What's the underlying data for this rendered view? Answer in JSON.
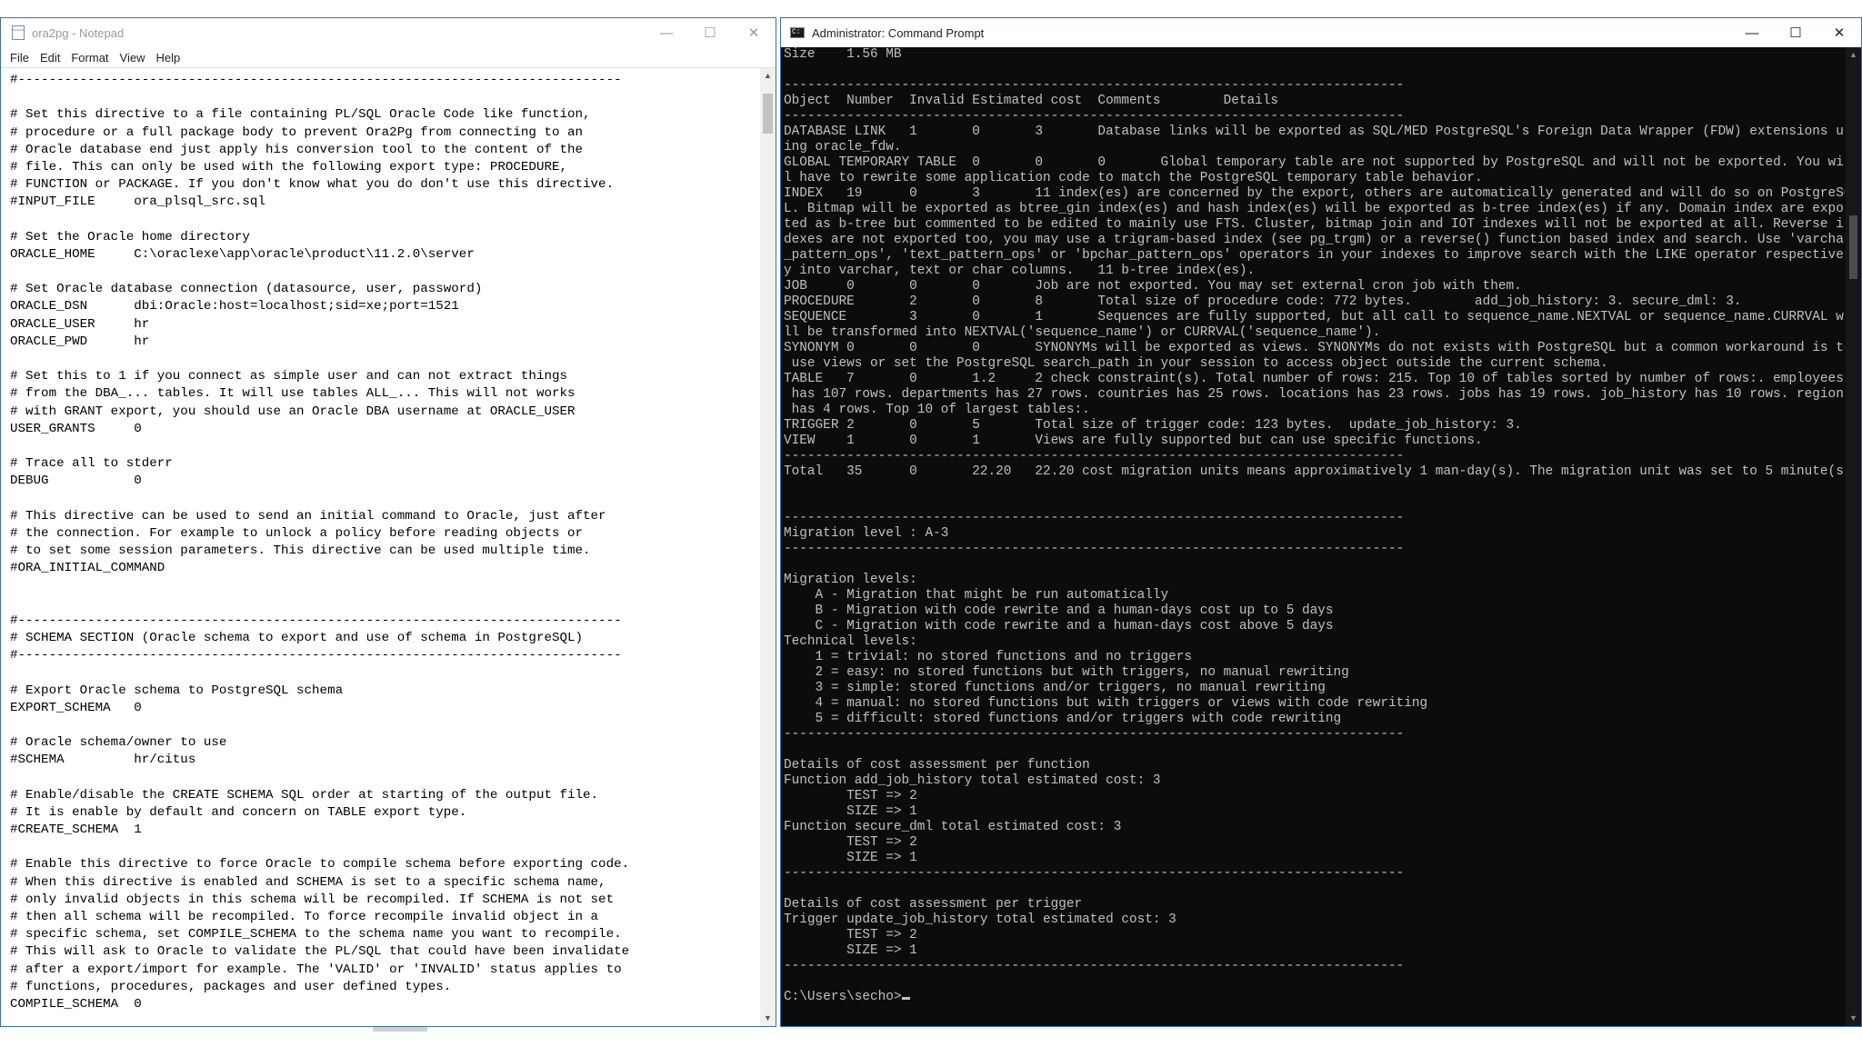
{
  "notepad": {
    "title": "ora2pg - Notepad",
    "menu": [
      "File",
      "Edit",
      "Format",
      "View",
      "Help"
    ],
    "lines": [
      "#------------------------------------------------------------------------------",
      "",
      "# Set this directive to a file containing PL/SQL Oracle Code like function,",
      "# procedure or a full package body to prevent Ora2Pg from connecting to an",
      "# Oracle database end just apply his conversion tool to the content of the",
      "# file. This can only be used with the following export type: PROCEDURE,",
      "# FUNCTION or PACKAGE. If you don't know what you do don't use this directive.",
      "#INPUT_FILE     ora_plsql_src.sql",
      "",
      "# Set the Oracle home directory",
      "ORACLE_HOME     C:\\oraclexe\\app\\oracle\\product\\11.2.0\\server",
      "",
      "# Set Oracle database connection (datasource, user, password)",
      "ORACLE_DSN      dbi:Oracle:host=localhost;sid=xe;port=1521",
      "ORACLE_USER     hr",
      "ORACLE_PWD      hr",
      "",
      "# Set this to 1 if you connect as simple user and can not extract things",
      "# from the DBA_... tables. It will use tables ALL_... This will not works",
      "# with GRANT export, you should use an Oracle DBA username at ORACLE_USER",
      "USER_GRANTS     0",
      "",
      "# Trace all to stderr",
      "DEBUG           0",
      "",
      "# This directive can be used to send an initial command to Oracle, just after",
      "# the connection. For example to unlock a policy before reading objects or",
      "# to set some session parameters. This directive can be used multiple time.",
      "#ORA_INITIAL_COMMAND",
      "",
      "",
      "#------------------------------------------------------------------------------",
      "# SCHEMA SECTION (Oracle schema to export and use of schema in PostgreSQL)",
      "#------------------------------------------------------------------------------",
      "",
      "# Export Oracle schema to PostgreSQL schema",
      "EXPORT_SCHEMA   0",
      "",
      "# Oracle schema/owner to use",
      "#SCHEMA         hr/citus",
      "",
      "# Enable/disable the CREATE SCHEMA SQL order at starting of the output file.",
      "# It is enable by default and concern on TABLE export type.",
      "#CREATE_SCHEMA  1",
      "",
      "# Enable this directive to force Oracle to compile schema before exporting code.",
      "# When this directive is enabled and SCHEMA is set to a specific schema name,",
      "# only invalid objects in this schema will be recompiled. If SCHEMA is not set",
      "# then all schema will be recompiled. To force recompile invalid object in a",
      "# specific schema, set COMPILE_SCHEMA to the schema name you want to recompile.",
      "# This will ask to Oracle to validate the PL/SQL that could have been invalidate",
      "# after a export/import for example. The 'VALID' or 'INVALID' status applies to",
      "# functions, procedures, packages and user defined types.",
      "COMPILE_SCHEMA  0"
    ]
  },
  "cmd": {
    "title": "Administrator: Command Prompt",
    "prompt": "C:\\Users\\secho>",
    "lines": [
      "Size    1.56 MB",
      "",
      "-------------------------------------------------------------------------------",
      "Object  Number  Invalid Estimated cost  Comments        Details",
      "-------------------------------------------------------------------------------",
      "DATABASE LINK   1       0       3       Database links will be exported as SQL/MED PostgreSQL's Foreign Data Wrapper (FDW) extensions us",
      "ing oracle_fdw.",
      "GLOBAL TEMPORARY TABLE  0       0       0       Global temporary table are not supported by PostgreSQL and will not be exported. You wil",
      "l have to rewrite some application code to match the PostgreSQL temporary table behavior.",
      "INDEX   19      0       3       11 index(es) are concerned by the export, others are automatically generated and will do so on PostgreSQ",
      "L. Bitmap will be exported as btree_gin index(es) and hash index(es) will be exported as b-tree index(es) if any. Domain index are expor",
      "ted as b-tree but commented to be edited to mainly use FTS. Cluster, bitmap join and IOT indexes will not be exported at all. Reverse in",
      "dexes are not exported too, you may use a trigram-based index (see pg_trgm) or a reverse() function based index and search. Use 'varchar",
      "_pattern_ops', 'text_pattern_ops' or 'bpchar_pattern_ops' operators in your indexes to improve search with the LIKE operator respectivel",
      "y into varchar, text or char columns.   11 b-tree index(es).",
      "JOB     0       0       0       Job are not exported. You may set external cron job with them.",
      "PROCEDURE       2       0       8       Total size of procedure code: 772 bytes.        add_job_history: 3. secure_dml: 3.",
      "SEQUENCE        3       0       1       Sequences are fully supported, but all call to sequence_name.NEXTVAL or sequence_name.CURRVAL wi",
      "ll be transformed into NEXTVAL('sequence_name') or CURRVAL('sequence_name').",
      "SYNONYM 0       0       0       SYNONYMs will be exported as views. SYNONYMs do not exists with PostgreSQL but a common workaround is to",
      " use views or set the PostgreSQL search_path in your session to access object outside the current schema.",
      "TABLE   7       0       1.2     2 check constraint(s). Total number of rows: 215. Top 10 of tables sorted by number of rows:. employees",
      " has 107 rows. departments has 27 rows. countries has 25 rows. locations has 23 rows. jobs has 19 rows. job_history has 10 rows. regions",
      " has 4 rows. Top 10 of largest tables:.",
      "TRIGGER 2       0       5       Total size of trigger code: 123 bytes.  update_job_history: 3.",
      "VIEW    1       0       1       Views are fully supported but can use specific functions.",
      "-------------------------------------------------------------------------------",
      "Total   35      0       22.20   22.20 cost migration units means approximatively 1 man-day(s). The migration unit was set to 5 minute(s)",
      "",
      "",
      "-------------------------------------------------------------------------------",
      "Migration level : A-3",
      "-------------------------------------------------------------------------------",
      "",
      "Migration levels:",
      "    A - Migration that might be run automatically",
      "    B - Migration with code rewrite and a human-days cost up to 5 days",
      "    C - Migration with code rewrite and a human-days cost above 5 days",
      "Technical levels:",
      "    1 = trivial: no stored functions and no triggers",
      "    2 = easy: no stored functions but with triggers, no manual rewriting",
      "    3 = simple: stored functions and/or triggers, no manual rewriting",
      "    4 = manual: no stored functions but with triggers or views with code rewriting",
      "    5 = difficult: stored functions and/or triggers with code rewriting",
      "-------------------------------------------------------------------------------",
      "",
      "Details of cost assessment per function",
      "Function add_job_history total estimated cost: 3",
      "        TEST => 2",
      "        SIZE => 1",
      "Function secure_dml total estimated cost: 3",
      "        TEST => 2",
      "        SIZE => 1",
      "-------------------------------------------------------------------------------",
      "",
      "Details of cost assessment per trigger",
      "Trigger update_job_history total estimated cost: 3",
      "        TEST => 2",
      "        SIZE => 1",
      "-------------------------------------------------------------------------------",
      ""
    ]
  }
}
